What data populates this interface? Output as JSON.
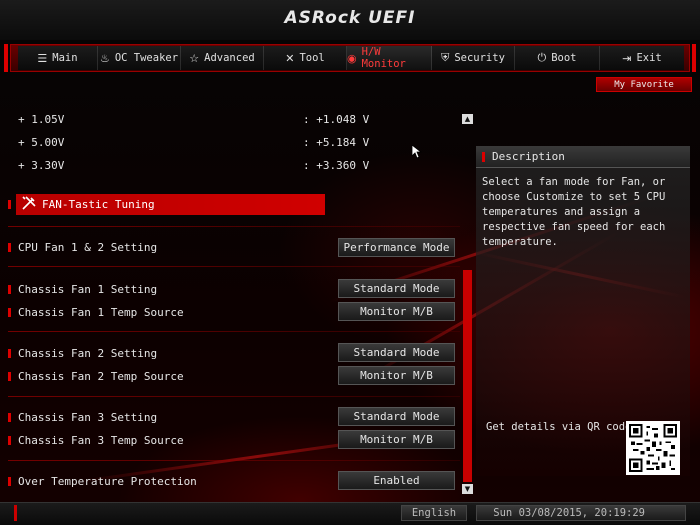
{
  "header": {
    "logo_text": "ASRock UEFI"
  },
  "tabs": [
    {
      "icon": "list-icon",
      "glyph": "☰",
      "label": "Main",
      "active": false
    },
    {
      "icon": "flame-icon",
      "glyph": "♨",
      "label": "OC Tweaker",
      "active": false
    },
    {
      "icon": "star-icon",
      "glyph": "☆",
      "label": "Advanced",
      "active": false
    },
    {
      "icon": "tools-icon",
      "glyph": "✕",
      "label": "Tool",
      "active": false
    },
    {
      "icon": "monitor-icon",
      "glyph": "◉",
      "label": "H/W Monitor",
      "active": true
    },
    {
      "icon": "shield-icon",
      "glyph": "⛨",
      "label": "Security",
      "active": false
    },
    {
      "icon": "power-icon",
      "glyph": "⏻",
      "label": "Boot",
      "active": false
    },
    {
      "icon": "exit-icon",
      "glyph": "⇥",
      "label": "Exit",
      "active": false
    }
  ],
  "favorite": {
    "label": "My Favorite"
  },
  "voltages": [
    {
      "label": "1.05V",
      "value": ": +1.048 V"
    },
    {
      "label": "5.00V",
      "value": ": +5.184 V"
    },
    {
      "label": "3.30V",
      "value": ": +3.360 V"
    }
  ],
  "fan_section": {
    "icon": "wrench-screwdriver-icon",
    "label": "FAN-Tastic Tuning"
  },
  "settings": [
    {
      "label": "CPU Fan 1 & 2 Setting",
      "value": "Performance Mode"
    },
    {
      "label": "Chassis Fan 1 Setting",
      "value": "Standard Mode"
    },
    {
      "label": "Chassis Fan 1 Temp Source",
      "value": "Monitor M/B"
    },
    {
      "label": "Chassis Fan 2 Setting",
      "value": "Standard Mode"
    },
    {
      "label": "Chassis Fan 2 Temp Source",
      "value": "Monitor M/B"
    },
    {
      "label": "Chassis Fan 3 Setting",
      "value": "Standard Mode"
    },
    {
      "label": "Chassis Fan 3 Temp Source",
      "value": "Monitor M/B"
    },
    {
      "label": "Over Temperature Protection",
      "value": "Enabled"
    }
  ],
  "description": {
    "title": "Description",
    "text": "Select a fan mode for Fan, or choose Customize to set 5 CPU temperatures and assign a respective fan speed for each temperature.",
    "qr_label": "Get details via QR code"
  },
  "footer": {
    "language": "English",
    "datetime": "Sun 03/08/2015, 20:19:29"
  },
  "colors": {
    "accent": "#d00000",
    "background": "#000000",
    "text": "#e6e6e6"
  }
}
